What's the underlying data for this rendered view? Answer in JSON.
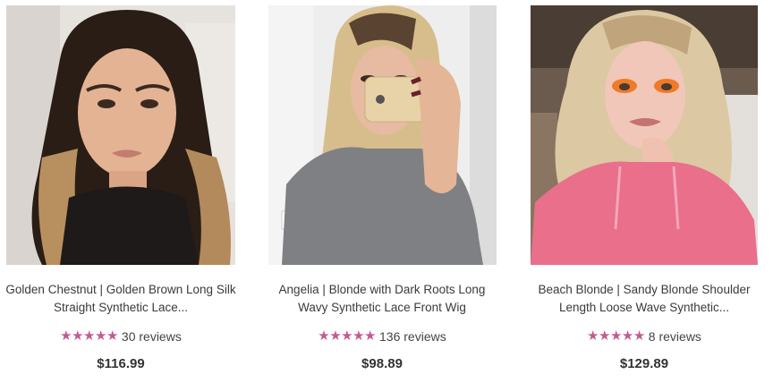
{
  "products": [
    {
      "title_line1": "Golden Chestnut | Golden Brown Long Silk",
      "title_line2": "Straight Synthetic Lace...",
      "stars": "★★★★★",
      "reviews": "30 reviews",
      "price": "$116.99"
    },
    {
      "title_line1": "Angelia | Blonde with Dark Roots Long",
      "title_line2": "Wavy Synthetic Lace Front Wig",
      "stars": "★★★★★",
      "reviews": "136 reviews",
      "price": "$98.89"
    },
    {
      "title_line1": "Beach Blonde | Sandy Blonde Shoulder",
      "title_line2": "Length Loose Wave Synthetic...",
      "stars": "★★★★★",
      "reviews": "8 reviews",
      "price": "$129.89"
    }
  ],
  "colors": {
    "star": "#c25b93",
    "price": "#333333",
    "title": "#3a3a3a"
  }
}
